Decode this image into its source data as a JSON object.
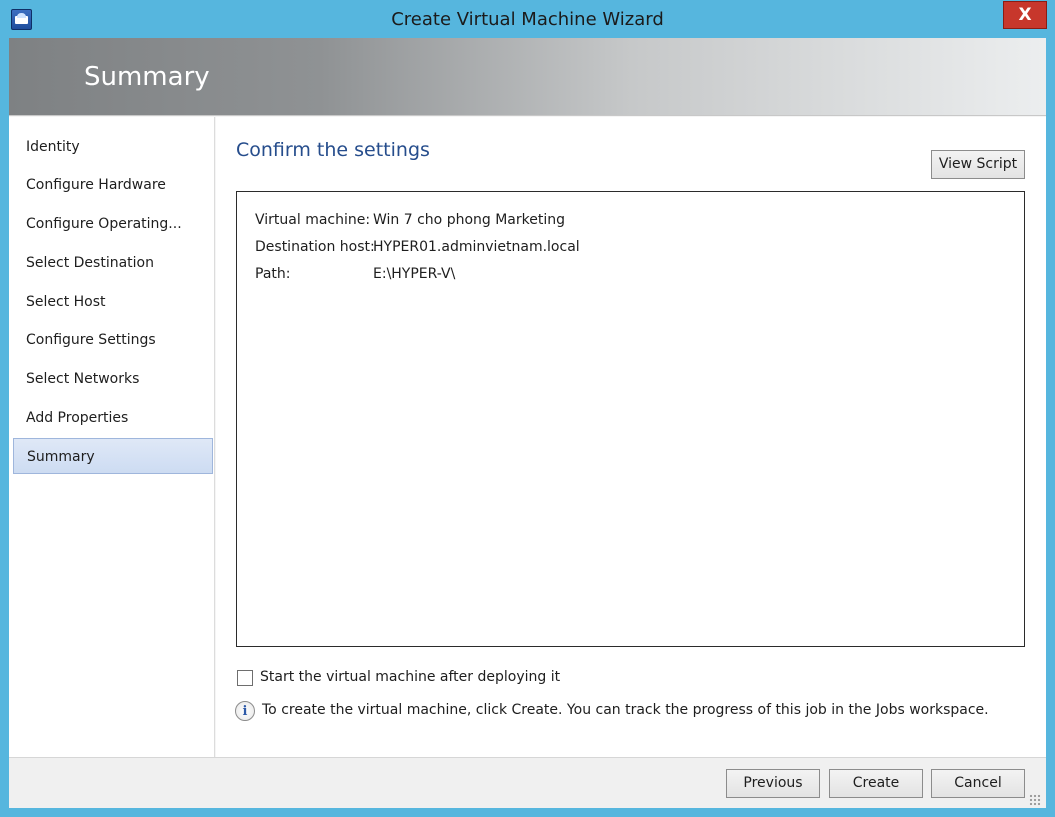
{
  "window": {
    "title": "Create Virtual Machine Wizard",
    "close_label": "X"
  },
  "header": {
    "title": "Summary"
  },
  "sidebar": {
    "items": [
      {
        "label": "Identity"
      },
      {
        "label": "Configure Hardware"
      },
      {
        "label": "Configure Operating..."
      },
      {
        "label": "Select Destination"
      },
      {
        "label": "Select Host"
      },
      {
        "label": "Configure Settings"
      },
      {
        "label": "Select Networks"
      },
      {
        "label": "Add Properties"
      },
      {
        "label": "Summary",
        "selected": true
      }
    ]
  },
  "main": {
    "heading": "Confirm the settings",
    "view_script_label": "View Script",
    "summary_rows": [
      {
        "label": "Virtual machine:",
        "value": "Win 7 cho phong Marketing"
      },
      {
        "label": "Destination host:",
        "value": "HYPER01.adminvietnam.local"
      },
      {
        "label": "Path:",
        "value": "E:\\HYPER-V\\"
      }
    ],
    "start_vm_checkbox": {
      "label": "Start the virtual machine after deploying it",
      "checked": false
    },
    "info_text": "To create the virtual machine, click Create. You can track the progress of this job in the Jobs workspace.",
    "info_icon": "info-icon"
  },
  "footer": {
    "previous_label": "Previous",
    "create_label": "Create",
    "cancel_label": "Cancel"
  },
  "colors": {
    "window_frame": "#56b6de",
    "heading": "#264d8c",
    "selected_item": "#cddcf2",
    "close_button": "#c7372c"
  }
}
